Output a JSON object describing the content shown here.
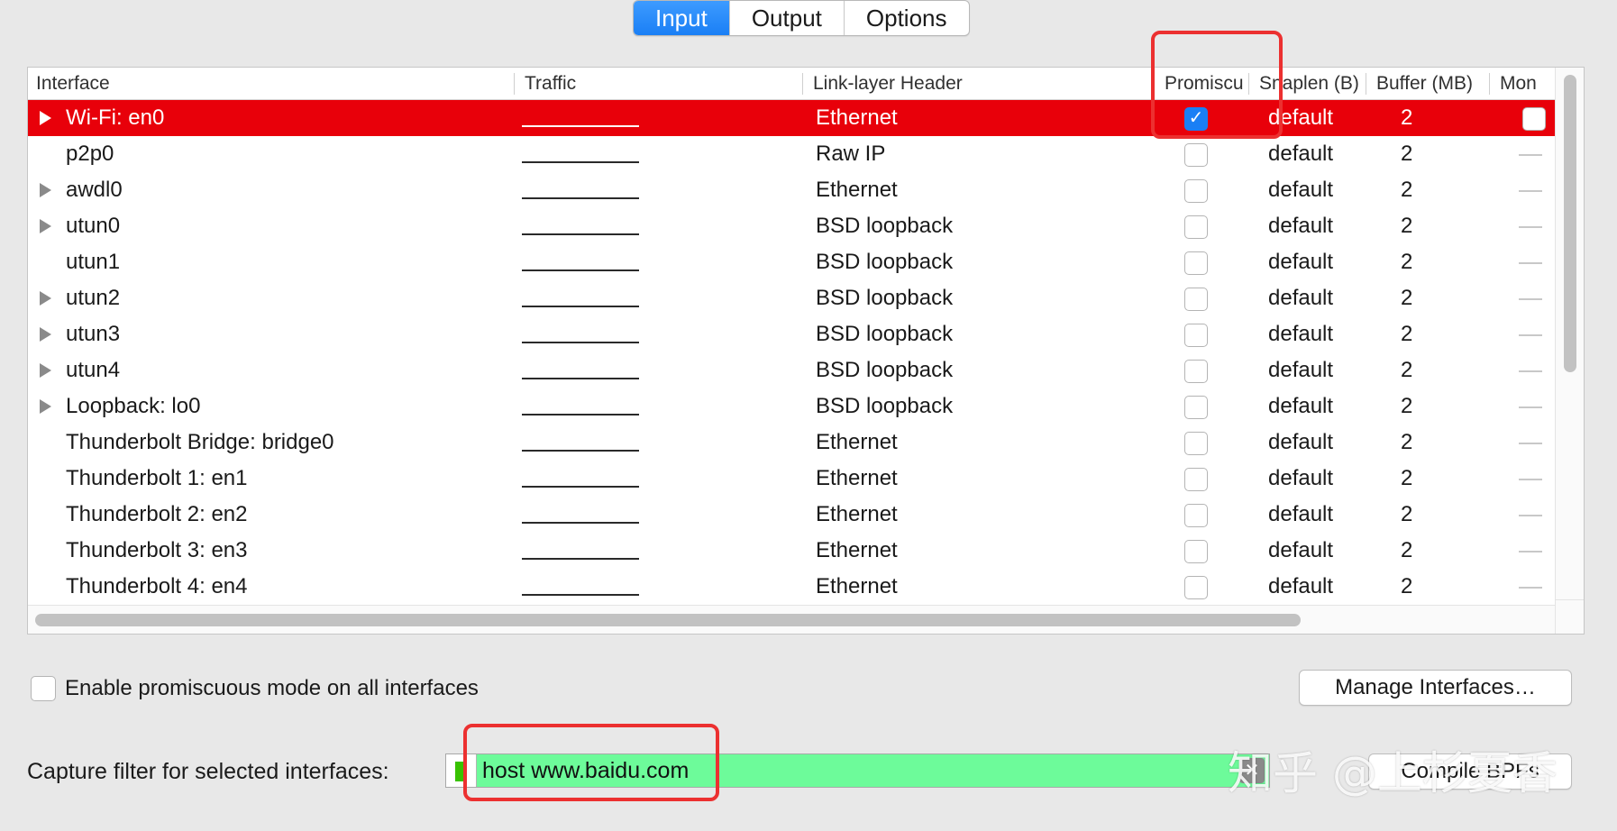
{
  "tabs": [
    {
      "label": "Input",
      "active": true
    },
    {
      "label": "Output",
      "active": false
    },
    {
      "label": "Options",
      "active": false
    }
  ],
  "columns": [
    "Interface",
    "Traffic",
    "Link-layer Header",
    "Promiscu",
    "Snaplen (B)",
    "Buffer (MB)",
    "Mon"
  ],
  "rows": [
    {
      "name": "Wi-Fi: en0",
      "expandable": true,
      "selected": true,
      "link": "Ethernet",
      "promisc": true,
      "snaplen": "default",
      "buffer": "2",
      "monitor": "checkbox"
    },
    {
      "name": "p2p0",
      "expandable": false,
      "selected": false,
      "link": "Raw IP",
      "promisc": false,
      "snaplen": "default",
      "buffer": "2",
      "monitor": "dash"
    },
    {
      "name": "awdl0",
      "expandable": true,
      "selected": false,
      "link": "Ethernet",
      "promisc": false,
      "snaplen": "default",
      "buffer": "2",
      "monitor": "dash"
    },
    {
      "name": "utun0",
      "expandable": true,
      "selected": false,
      "link": "BSD loopback",
      "promisc": false,
      "snaplen": "default",
      "buffer": "2",
      "monitor": "dash"
    },
    {
      "name": "utun1",
      "expandable": false,
      "selected": false,
      "link": "BSD loopback",
      "promisc": false,
      "snaplen": "default",
      "buffer": "2",
      "monitor": "dash"
    },
    {
      "name": "utun2",
      "expandable": true,
      "selected": false,
      "link": "BSD loopback",
      "promisc": false,
      "snaplen": "default",
      "buffer": "2",
      "monitor": "dash"
    },
    {
      "name": "utun3",
      "expandable": true,
      "selected": false,
      "link": "BSD loopback",
      "promisc": false,
      "snaplen": "default",
      "buffer": "2",
      "monitor": "dash"
    },
    {
      "name": "utun4",
      "expandable": true,
      "selected": false,
      "link": "BSD loopback",
      "promisc": false,
      "snaplen": "default",
      "buffer": "2",
      "monitor": "dash"
    },
    {
      "name": "Loopback: lo0",
      "expandable": true,
      "selected": false,
      "link": "BSD loopback",
      "promisc": false,
      "snaplen": "default",
      "buffer": "2",
      "monitor": "dash"
    },
    {
      "name": "Thunderbolt Bridge: bridge0",
      "expandable": false,
      "selected": false,
      "link": "Ethernet",
      "promisc": false,
      "snaplen": "default",
      "buffer": "2",
      "monitor": "dash"
    },
    {
      "name": "Thunderbolt 1: en1",
      "expandable": false,
      "selected": false,
      "link": "Ethernet",
      "promisc": false,
      "snaplen": "default",
      "buffer": "2",
      "monitor": "dash"
    },
    {
      "name": "Thunderbolt 2: en2",
      "expandable": false,
      "selected": false,
      "link": "Ethernet",
      "promisc": false,
      "snaplen": "default",
      "buffer": "2",
      "monitor": "dash"
    },
    {
      "name": "Thunderbolt 3: en3",
      "expandable": false,
      "selected": false,
      "link": "Ethernet",
      "promisc": false,
      "snaplen": "default",
      "buffer": "2",
      "monitor": "dash"
    },
    {
      "name": "Thunderbolt 4: en4",
      "expandable": false,
      "selected": false,
      "link": "Ethernet",
      "promisc": false,
      "snaplen": "default",
      "buffer": "2",
      "monitor": "dash"
    }
  ],
  "promisc_all_label": "Enable promiscuous mode on all interfaces",
  "manage_button": "Manage Interfaces…",
  "filter": {
    "label": "Capture filter for selected interfaces:",
    "value": "host www.baidu.com",
    "compile_button": "Compile BPFs"
  },
  "watermark": "知乎 @上杉夏香",
  "colors": {
    "selected_row": "#e8000a",
    "accent": "#1a7ff5",
    "filter_valid": "#6dfb9a",
    "highlight": "#ec3030"
  }
}
